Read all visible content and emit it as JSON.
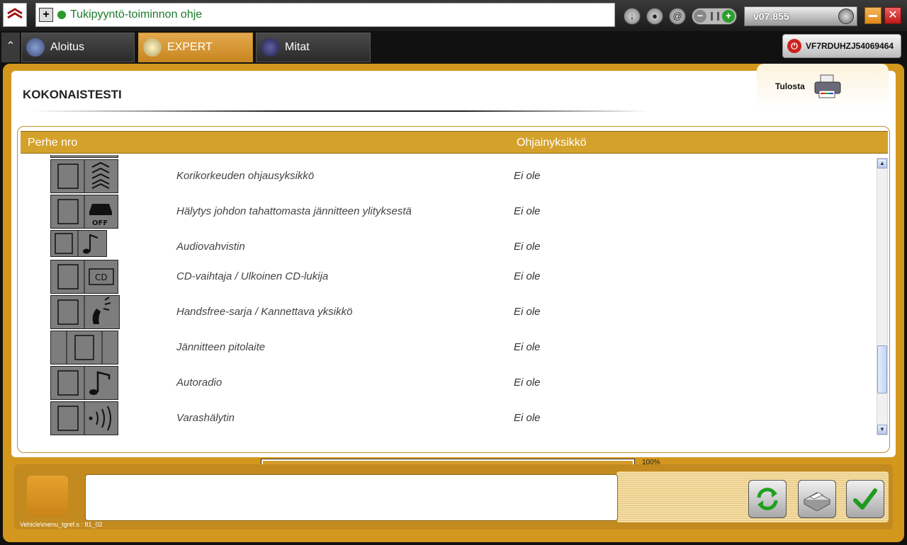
{
  "help": {
    "title": "Tukipyyntö-toiminnon ohje"
  },
  "version": "v07.855",
  "tabs": {
    "aloitus": "Aloitus",
    "expert": "EXPERT",
    "mitat": "Mitat"
  },
  "vin": "VF7RDUHZJ54069464",
  "page": {
    "title": "KOKONAISTESTI",
    "print_label": "Tulosta"
  },
  "table": {
    "columns": {
      "family": "Perhe nro",
      "unit": "Ohjainyksikkö"
    },
    "rows": [
      {
        "name": "Korikorkeuden ohjausyksikkö",
        "status": "Ei ole",
        "icon": "suspension-icon"
      },
      {
        "name": "Hälytys johdon tahattomasta jännitteen ylityksestä",
        "status": "Ei ole",
        "icon": "car-off-icon"
      },
      {
        "name": "Audiovahvistin",
        "status": "Ei ole",
        "icon": "music-note-icon"
      },
      {
        "name": "CD-vaihtaja / Ulkoinen CD-lukija",
        "status": "Ei ole",
        "icon": "cd-icon"
      },
      {
        "name": "Handsfree-sarja / Kannettava yksikkö",
        "status": "Ei ole",
        "icon": "handsfree-icon"
      },
      {
        "name": "Jännitteen pitolaite",
        "status": "Ei ole",
        "icon": "voltage-holder-icon"
      },
      {
        "name": "Autoradio",
        "status": "Ei ole",
        "icon": "music-note-icon"
      },
      {
        "name": "Varashälytin",
        "status": "Ei ole",
        "icon": "alarm-signal-icon"
      }
    ]
  },
  "progress": {
    "value": 100,
    "label": "100%"
  },
  "footer": {
    "vehicle_path": "Vehicle\\menu_tgref.s : 81_02"
  },
  "colors": {
    "accent": "#d3971d",
    "header": "#d4a22b",
    "progress": "#d49a2a"
  }
}
